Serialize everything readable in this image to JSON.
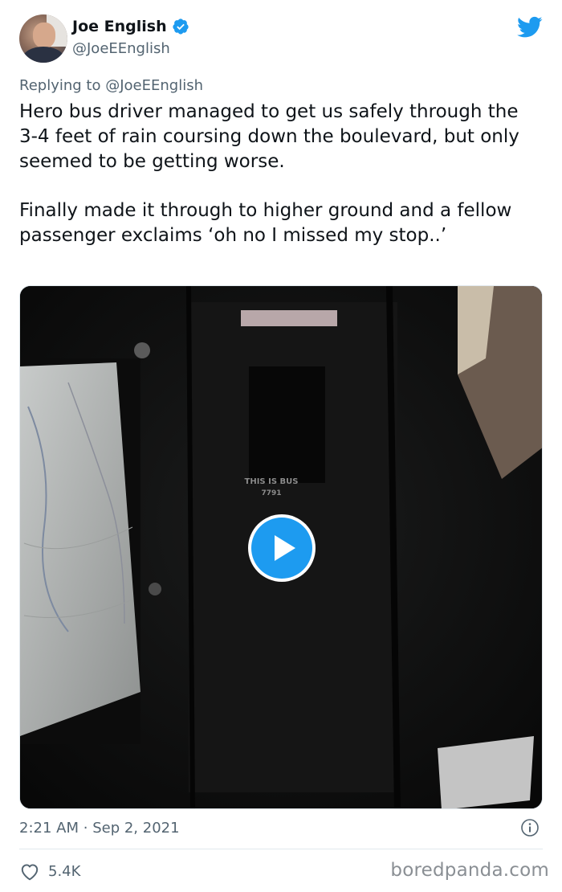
{
  "author": {
    "display_name": "Joe English",
    "handle": "@JoeEEnglish",
    "verified": true
  },
  "reply_context": {
    "prefix": "Replying to",
    "mention": "@JoeEEnglish"
  },
  "tweet": {
    "paragraphs": [
      "Hero bus driver managed to get us safely through the 3-4 feet of rain coursing down the boulevard, but only seemed to be getting worse.",
      "Finally made it through to higher ground and a fellow passenger exclaims ‘oh no I missed my stop..’"
    ]
  },
  "media": {
    "type": "video",
    "sign_text_line1": "THIS IS BUS",
    "sign_text_line2": "7791"
  },
  "meta": {
    "time": "2:21 AM",
    "separator": "·",
    "date": "Sep 2, 2021"
  },
  "engagement": {
    "likes": "5.4K"
  },
  "watermark": "boredpanda.com",
  "icons": {
    "verified": "verified-badge-icon",
    "brand": "twitter-bird-icon",
    "play": "play-icon",
    "info": "info-icon",
    "like": "heart-icon"
  },
  "colors": {
    "brand_blue": "#1d9bf0",
    "secondary_text": "#536471",
    "primary_text": "#0f1419"
  }
}
